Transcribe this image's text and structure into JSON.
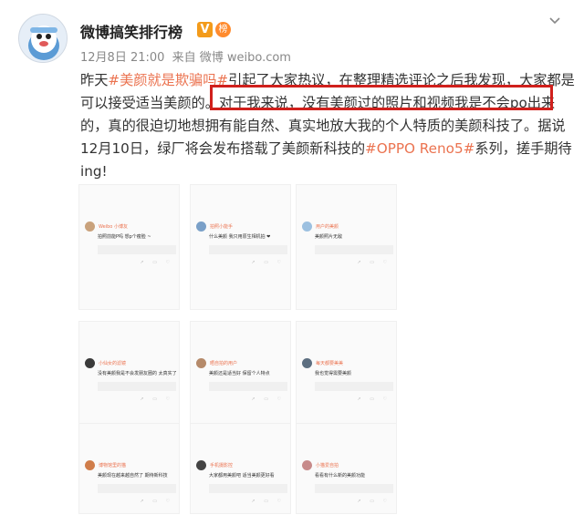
{
  "header": {
    "username": "微博搞笑排行榜",
    "verified_badge": "V",
    "rank_badge": "榜",
    "time": "12月8日 21:00",
    "source_prefix": "来自",
    "source": "微博 weibo.com"
  },
  "post": {
    "line1_a": "昨天",
    "line1_tag": "#美颜就是欺骗吗#",
    "line1_b": "引起了大家热议，在整理精选评论之后我发现，大家都是",
    "line2_a": "可以接受适当美颜的。",
    "line2_b": "对于我来说，没有美颜过的照片和视频我是不会po出来",
    "line3": "的，真的很迫切地想拥有能自然、真实地放大我的个人特质的美颜科技了。据说",
    "line4_a": "12月10日，绿厂将会发布搭载了美颜新科技的",
    "line4_tag": "#OPPO Reno5#",
    "line4_b": "系列，搓手期待",
    "line5": "ing!"
  },
  "comments": [
    {
      "name": "Weibo 小博友",
      "text": "拍照前能P吗 想p个瘦脸 ~",
      "reply": "",
      "av": "#c9a27c"
    },
    {
      "name": "拍照小能手",
      "text": "什么美颜 我只用原生相机拍 ❤",
      "reply": "",
      "av": "#7aa0c8"
    },
    {
      "name": "用户的美颜",
      "text": "美颜照片无敌",
      "reply": "",
      "av": "#9cc0e0"
    },
    {
      "name": "小仙女的滤镜",
      "text": "没有美颜我是不会发朋友圈的 太真实了",
      "reply": "",
      "av": "#3a3a3a"
    },
    {
      "name": "晒自拍的用户",
      "text": "美颜还是适当好 保留个人特点",
      "reply": "",
      "av": "#b58a6a"
    },
    {
      "name": "每天都要美美",
      "text": "我也觉得需要美颜",
      "reply": "",
      "av": "#5c6e80"
    },
    {
      "name": "博物馆里的猫",
      "text": "美颜现在越来越自然了 期待新科技",
      "reply": "",
      "av": "#d07d4a"
    },
    {
      "name": "手机摄影控",
      "text": "大家都用美颜吧 适当美颜更好看",
      "reply": "",
      "av": "#444"
    },
    {
      "name": "小猫爱自拍",
      "text": "看看有什么新的美颜功能",
      "reply": "",
      "av": "#c78a8a"
    }
  ],
  "colors": {
    "accent": "#eb7350",
    "highlight_border": "#d0201c",
    "verified": "#f39b1b"
  }
}
